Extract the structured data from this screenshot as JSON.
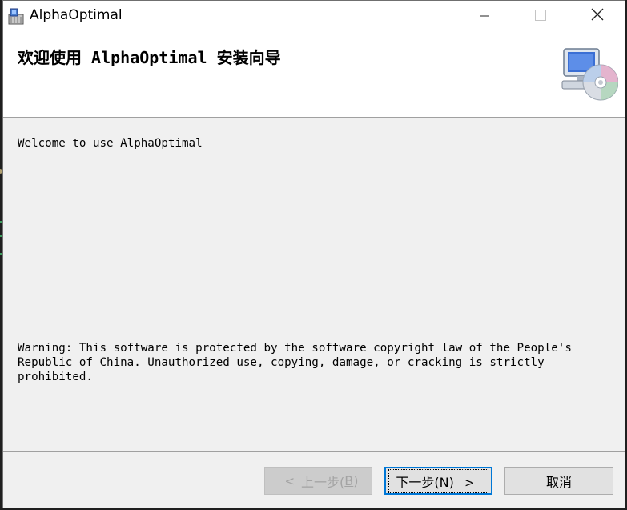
{
  "window": {
    "title": "AlphaOptimal",
    "icons": {
      "app": "installer-icon",
      "minimize": "minimize-icon",
      "maximize": "maximize-icon",
      "close": "close-icon"
    }
  },
  "banner": {
    "title": "欢迎使用 AlphaOptimal 安装向导",
    "icon": "computer-cd-icon"
  },
  "content": {
    "welcome": "Welcome to use AlphaOptimal",
    "warning": "Warning: This software is protected by the software copyright law of the People's\nRepublic of China. Unauthorized use, copying, damage, or cracking is strictly\nprohibited."
  },
  "buttons": {
    "back": {
      "label": "上一步(",
      "mnemonic": "B",
      "suffix": ")",
      "chevron": "<",
      "disabled": true
    },
    "next": {
      "label": "下一步(",
      "mnemonic": "N",
      "suffix": ")",
      "chevron": ">",
      "focused": true
    },
    "cancel": {
      "label": "取消"
    }
  },
  "colors": {
    "window_bg": "#f0f0f0",
    "banner_bg": "#ffffff",
    "focus_border": "#0078d7",
    "disabled_text": "#a3a3a3"
  }
}
